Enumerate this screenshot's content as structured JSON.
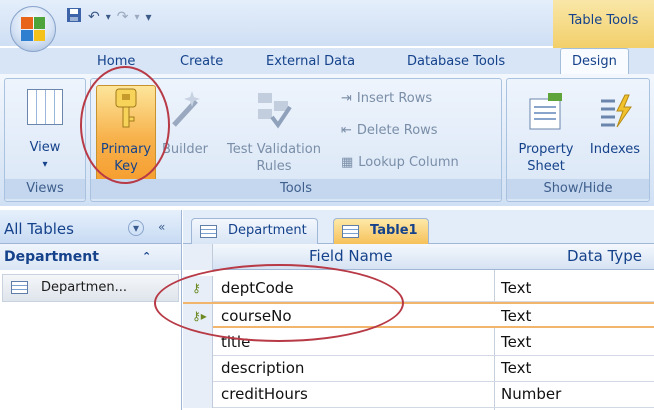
{
  "quick_access": {
    "save_icon": "save-icon",
    "undo_icon": "undo-icon",
    "redo_icon": "redo-icon",
    "customize": "▾"
  },
  "contextual": {
    "label": "Table Tools"
  },
  "tabs": [
    {
      "label": "Home"
    },
    {
      "label": "Create"
    },
    {
      "label": "External Data"
    },
    {
      "label": "Database Tools"
    },
    {
      "label": "Design"
    }
  ],
  "ribbon": {
    "views": {
      "view_label_1": "View",
      "view_label_2": "▾",
      "group_label": "Views"
    },
    "tools": {
      "primary_key_1": "Primary",
      "primary_key_2": "Key",
      "builder": "Builder",
      "test_validation_1": "Test Validation",
      "test_validation_2": "Rules",
      "insert_rows": "Insert Rows",
      "delete_rows": "Delete Rows",
      "lookup_column": "Lookup Column",
      "group_label": "Tools"
    },
    "show_hide": {
      "property_sheet_1": "Property",
      "property_sheet_2": "Sheet",
      "indexes": "Indexes",
      "group_label": "Show/Hide"
    }
  },
  "nav": {
    "title": "All Tables",
    "group": "Department",
    "items": [
      {
        "label": "Departmen..."
      }
    ]
  },
  "doc_tabs": [
    {
      "label": "Department"
    },
    {
      "label": "Table1"
    }
  ],
  "grid": {
    "headers": {
      "field_name": "Field Name",
      "data_type": "Data Type"
    },
    "rows": [
      {
        "field": "deptCode",
        "type": "Text",
        "key": true
      },
      {
        "field": "courseNo",
        "type": "Text",
        "key": true
      },
      {
        "field": "title",
        "type": "Text",
        "key": false
      },
      {
        "field": "description",
        "type": "Text",
        "key": false
      },
      {
        "field": "creditHours",
        "type": "Number",
        "key": false
      }
    ]
  },
  "colors": {
    "accent": "#15428b",
    "highlight": "#f7b24c",
    "annotation": "#b73a46"
  }
}
